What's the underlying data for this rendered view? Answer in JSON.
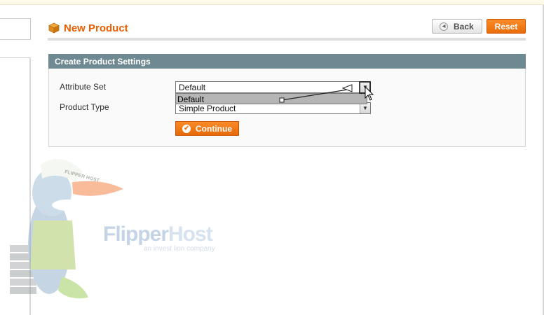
{
  "header": {
    "title": "New Product",
    "back_label": "Back",
    "reset_label": "Reset"
  },
  "section": {
    "title": "Create Product Settings"
  },
  "form": {
    "attribute_set_label": "Attribute Set",
    "attribute_set_value": "Default",
    "attribute_set_dropdown_option": "Default",
    "product_type_label": "Product Type",
    "product_type_value": "Simple Product",
    "continue_label": "Continue"
  },
  "watermark": {
    "brand_flipper": "Flipper",
    "brand_host": "Host",
    "tagline": "an invest lion company",
    "cap_text": "FLIPPER HOST"
  },
  "colors": {
    "accent": "#eb5e00",
    "section_header": "#6f8992",
    "button_orange": "#f07a17"
  },
  "icons": {
    "header": "product-box-icon",
    "back": "left-arrow-circle-icon",
    "continue": "checkmark-circle-icon",
    "select_arrow": "chevron-down-icon",
    "cursor": "mouse-pointer-icon"
  }
}
